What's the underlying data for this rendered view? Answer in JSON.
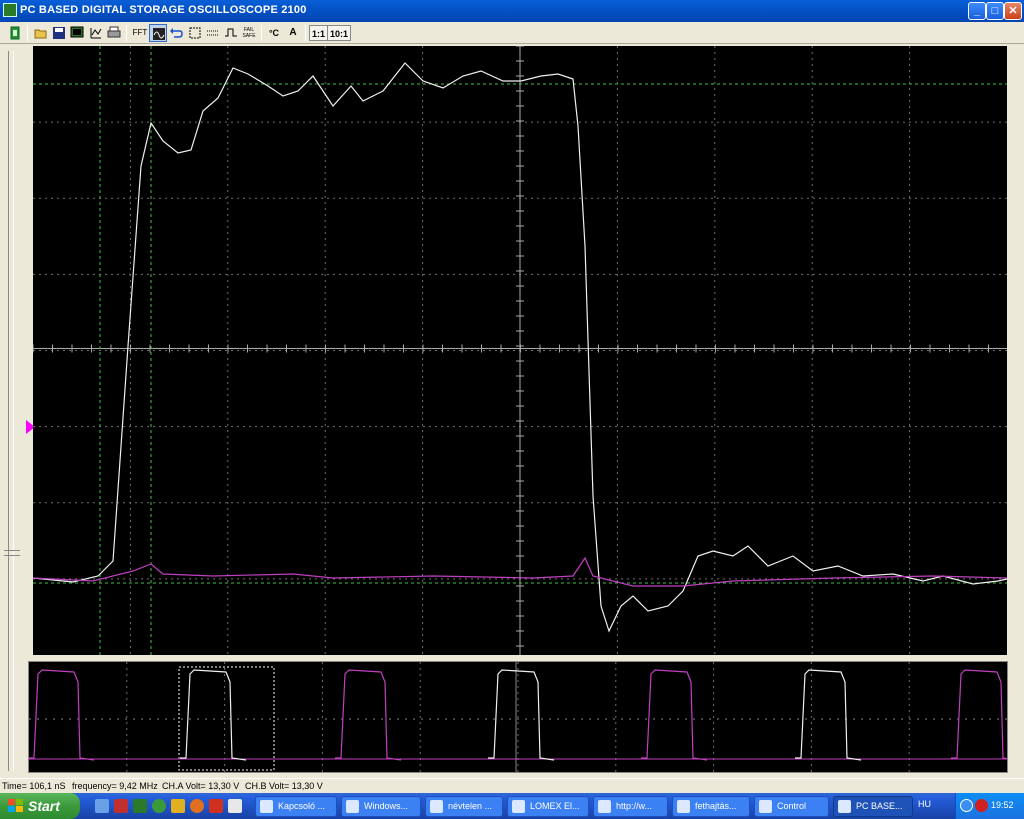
{
  "window": {
    "title": "PC BASED DIGITAL STORAGE OSCILLOSCOPE 2100",
    "controls": {
      "minimize": "_",
      "maximize": "□",
      "close": "✕"
    }
  },
  "toolbar": {
    "items": [
      {
        "name": "exit-icon",
        "label": ""
      },
      {
        "name": "open-icon",
        "label": ""
      },
      {
        "name": "save-icon",
        "label": ""
      },
      {
        "name": "screen-icon",
        "label": ""
      },
      {
        "name": "graph-icon",
        "label": ""
      },
      {
        "name": "print-icon",
        "label": ""
      },
      {
        "name": "fft-icon",
        "label": "FFT"
      },
      {
        "name": "scope-mode-icon",
        "label": ""
      },
      {
        "name": "undo-icon",
        "label": ""
      },
      {
        "name": "cursor-box-icon",
        "label": ""
      },
      {
        "name": "dotted-line-icon",
        "label": ""
      },
      {
        "name": "waveform-icon",
        "label": ""
      },
      {
        "name": "fail-safe-icon",
        "label": "FAIL SAFE"
      },
      {
        "name": "celsius-icon",
        "label": "°C"
      },
      {
        "name": "amp-icon",
        "label": "A"
      }
    ],
    "ratio_1": "1:1",
    "ratio_10": "10:1"
  },
  "status": {
    "time": "Time= 106,1 nS",
    "frequency": "frequency= 9,42 MHz",
    "cha_volt": "CH.A Volt= 13,30 V",
    "chb_volt": "CH.B Volt= 13,30 V"
  },
  "colors": {
    "trace_a": "#f0f0f0",
    "trace_b": "#c040c0",
    "grid": "#707070",
    "cursor": "#40c040"
  },
  "taskbar": {
    "start_label": "Start",
    "tasks": [
      {
        "label": "Kapcsoló ...",
        "active": false
      },
      {
        "label": "Windows...",
        "active": false
      },
      {
        "label": "névtelen ...",
        "active": false
      },
      {
        "label": "LOMEX El...",
        "active": false
      },
      {
        "label": "http://w...",
        "active": false
      },
      {
        "label": "fethajtás...",
        "active": false
      },
      {
        "label": "Control",
        "active": false
      },
      {
        "label": "PC BASE...",
        "active": true
      }
    ],
    "language": "HU",
    "clock": "19:52"
  }
}
